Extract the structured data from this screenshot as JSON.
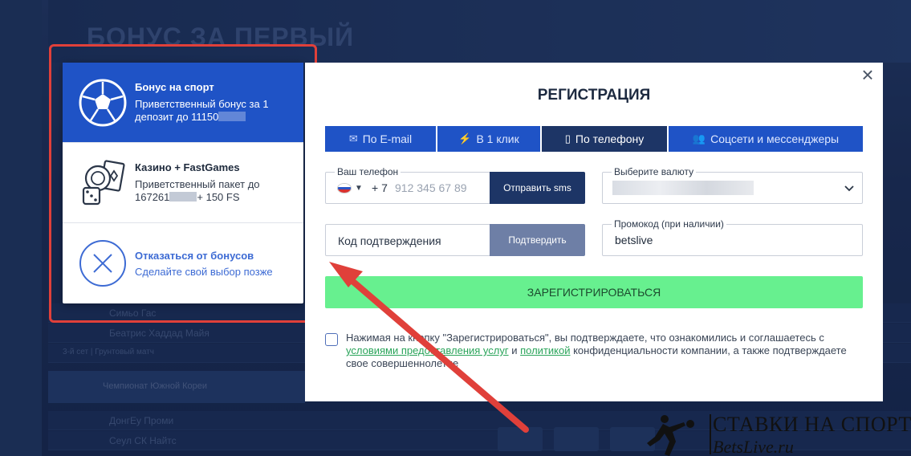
{
  "background": {
    "banner_title": "БОНУС ЗА ПЕРВЫЙ",
    "rows": [
      "Симьо Гас",
      "Беатрис Хаддад Майя",
      "3-й сет | Грунтовый матч"
    ],
    "league": "Чемпионат Южной Кореи",
    "bottom_rows": [
      "ДонгЕу Проми",
      "Сеул СК Найтс"
    ]
  },
  "bonus_panel": {
    "items": [
      {
        "title": "Бонус на спорт",
        "desc": "Приветственный бонус за 1 депозит до 11150",
        "icon": "soccer-ball-icon"
      },
      {
        "title": "Казино + FastGames",
        "desc_prefix": "Приветственный пакет до 167261",
        "desc_suffix": "+ 150 FS",
        "icon": "casino-chips-icon"
      },
      {
        "title": "Отказаться от бонусов",
        "desc": "Сделайте свой выбор позже",
        "icon": "close-circle-icon"
      }
    ]
  },
  "modal": {
    "title": "РЕГИСТРАЦИЯ",
    "close": "×",
    "tabs": [
      {
        "label": "По E-mail",
        "icon": "✉"
      },
      {
        "label": "В 1 клик",
        "icon": "⚡"
      },
      {
        "label": "По телефону",
        "icon": "▯"
      },
      {
        "label": "Соцсети и мессенджеры",
        "icon": "👥"
      }
    ],
    "phone": {
      "label": "Ваш телефон",
      "code": "+ 7",
      "placeholder": "912 345 67 89"
    },
    "send_sms": "Отправить sms",
    "currency": {
      "label": "Выберите валюту"
    },
    "code": {
      "placeholder": "Код подтверждения"
    },
    "confirm": "Подтвердить",
    "promo": {
      "label": "Промокод (при наличии)",
      "value": "betslive"
    },
    "register": "ЗАРЕГИСТРИРОВАТЬСЯ",
    "consent": {
      "part1": "Нажимая на кнопку \"Зарегистрироваться\", вы подтверждаете, что ознакомились и соглашаетесь с ",
      "link1": "условиями предоставления услуг",
      "part2": " и ",
      "link2": "политикой",
      "part3": " конфиденциальности компании, а также подтверждаете свое совершеннолетие"
    }
  },
  "watermark": {
    "line1": "СТАВКИ НА СПОРТ",
    "line2": "BetsLive.ru"
  },
  "colors": {
    "accent": "#1f53c6",
    "dark": "#1d3566",
    "register": "#67f08f",
    "frame": "#e0403a"
  }
}
